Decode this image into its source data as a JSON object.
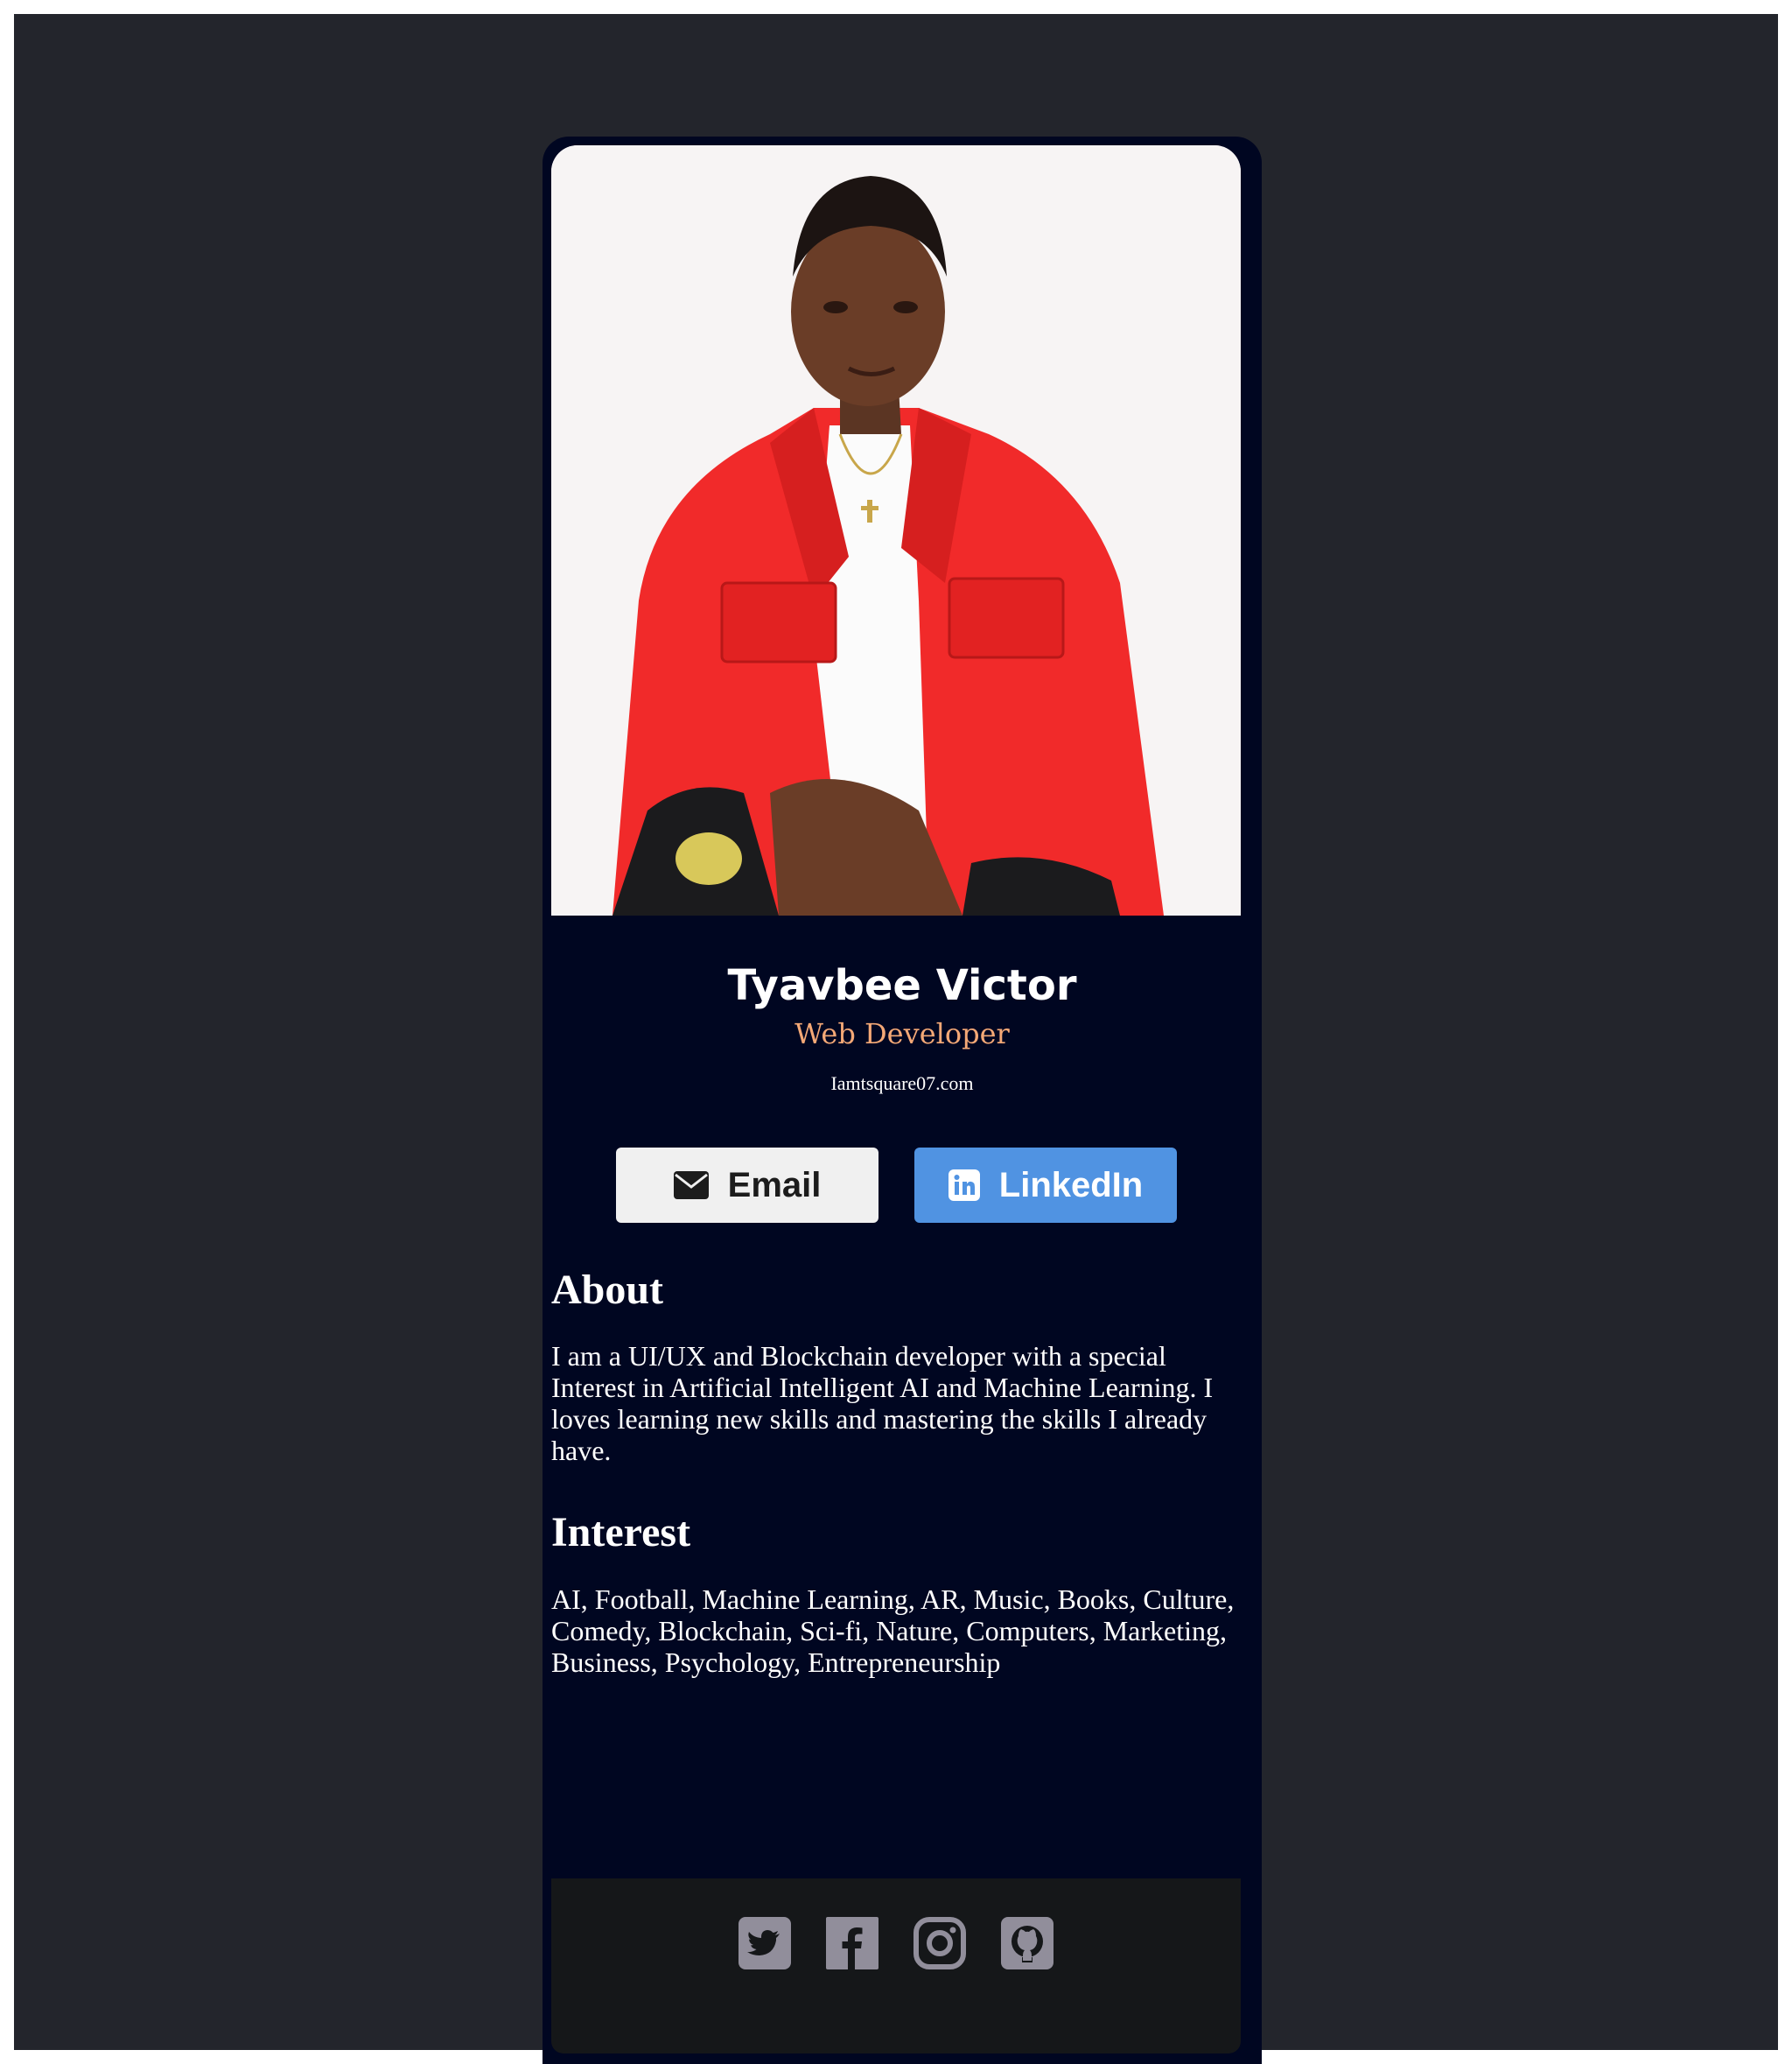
{
  "profile": {
    "photo_icon": "profile-photo",
    "name": "Tyavbee Victor",
    "role": "Web Developer",
    "website": "Iamtsquare07.com"
  },
  "buttons": {
    "email_label": "Email",
    "email_icon": "envelope-icon",
    "linkedin_label": "LinkedIn",
    "linkedin_icon": "linkedin-icon"
  },
  "about": {
    "heading": "About",
    "text": "I am a UI/UX and Blockchain developer with a special Interest in Artificial Intelligent AI and Machine Learning. I loves learning new skills and mastering the skills I already have."
  },
  "interest": {
    "heading": "Interest",
    "text": "AI, Football, Machine Learning, AR, Music, Books, Culture, Comedy, Blockchain, Sci-fi, Nature, Computers, Marketing, Business, Psychology, Entrepreneurship"
  },
  "footer": {
    "icons": [
      "twitter-icon",
      "facebook-icon",
      "instagram-icon",
      "github-icon"
    ],
    "icon_color": "#918e9b"
  },
  "colors": {
    "page_bg": "#23252c",
    "card_bg": "#000621",
    "role_accent": "#f4a876",
    "linkedin_blue": "#5093e2",
    "email_bg": "#f0f0f0",
    "footer_bg": "#151719"
  }
}
